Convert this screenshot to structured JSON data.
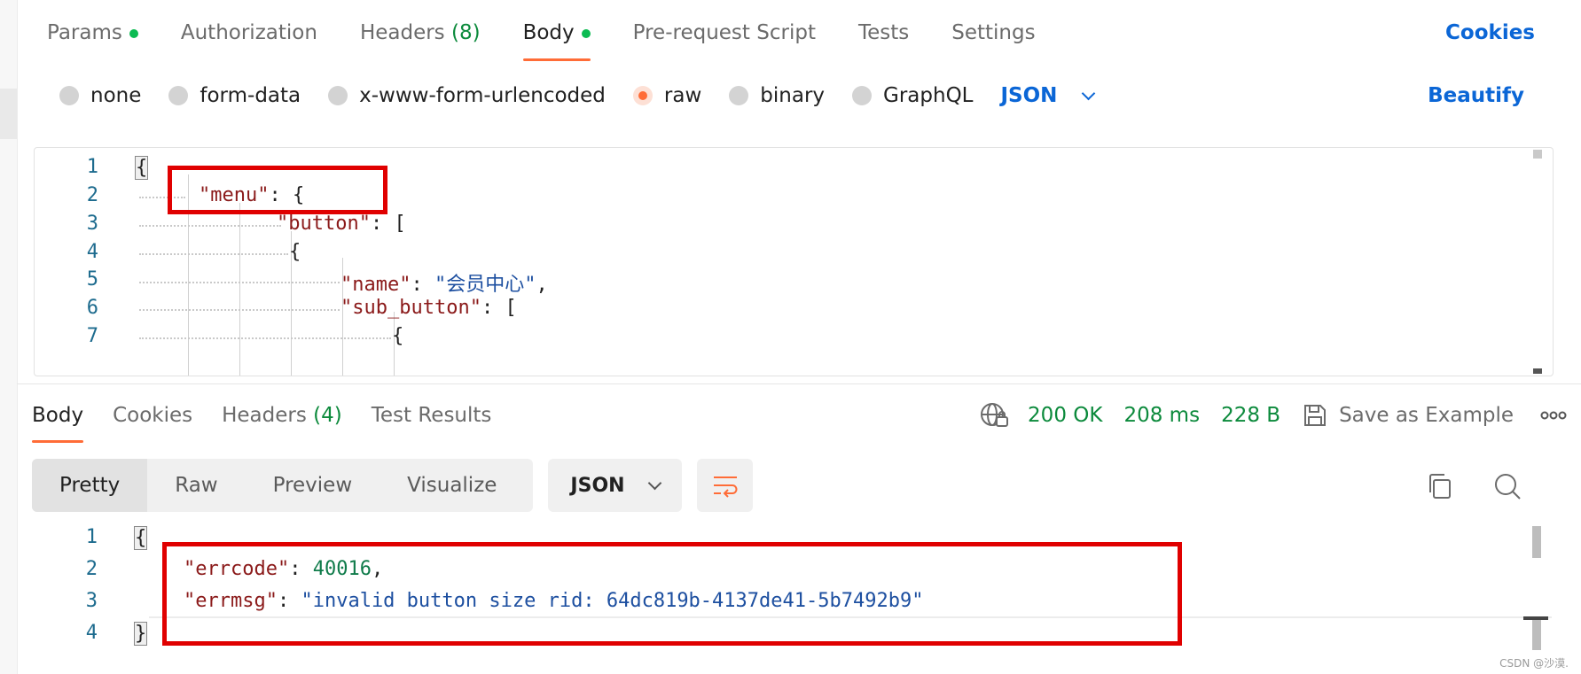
{
  "request_tabs": {
    "params": "Params",
    "authorization": "Authorization",
    "headers": "Headers",
    "headers_count": "(8)",
    "body": "Body",
    "pre_request": "Pre-request Script",
    "tests": "Tests",
    "settings": "Settings",
    "cookies": "Cookies"
  },
  "body_types": {
    "none": "none",
    "form_data": "form-data",
    "urlencoded": "x-www-form-urlencoded",
    "raw": "raw",
    "binary": "binary",
    "graphql": "GraphQL",
    "language": "JSON",
    "beautify": "Beautify"
  },
  "request_code": {
    "lines": [
      "1",
      "2",
      "3",
      "4",
      "5",
      "6",
      "7"
    ],
    "l1_brace": "{",
    "l2_key": "\"menu\"",
    "l2_rest": ": {",
    "l3_key": "\"button\"",
    "l3_rest": ": [",
    "l4_brace": "{",
    "l5_key": "\"name\"",
    "l5_colon": ": ",
    "l5_val": "\"会员中心\"",
    "l5_comma": ",",
    "l6_key": "\"sub_button\"",
    "l6_rest": ": [",
    "l7_brace": "{"
  },
  "response_tabs": {
    "body": "Body",
    "cookies": "Cookies",
    "headers": "Headers",
    "headers_count": "(4)",
    "test_results": "Test Results"
  },
  "response_status": {
    "status": "200 OK",
    "time": "208 ms",
    "size": "228 B",
    "save_example": "Save as Example"
  },
  "view_modes": {
    "pretty": "Pretty",
    "raw": "Raw",
    "preview": "Preview",
    "visualize": "Visualize",
    "format": "JSON"
  },
  "response_code": {
    "lines": [
      "1",
      "2",
      "3",
      "4"
    ],
    "l1_brace": "{",
    "l2_key": "\"errcode\"",
    "l2_colon": ": ",
    "l2_val": "40016",
    "l2_comma": ",",
    "l3_key": "\"errmsg\"",
    "l3_colon": ": ",
    "l3_val": "\"invalid button size rid: 64dc819b-4137de41-5b7492b9\"",
    "l4_brace": "}"
  },
  "watermark": "CSDN @沙漠.",
  "colors": {
    "accent": "#ff6c37",
    "link": "#0b66d6",
    "success": "#0c8a3c",
    "highlight_box": "#e00000"
  },
  "icons": [
    "globe-lock-icon",
    "save-icon",
    "more-icon",
    "chevron-down-icon",
    "wrap-lines-icon",
    "copy-icon",
    "search-icon"
  ]
}
